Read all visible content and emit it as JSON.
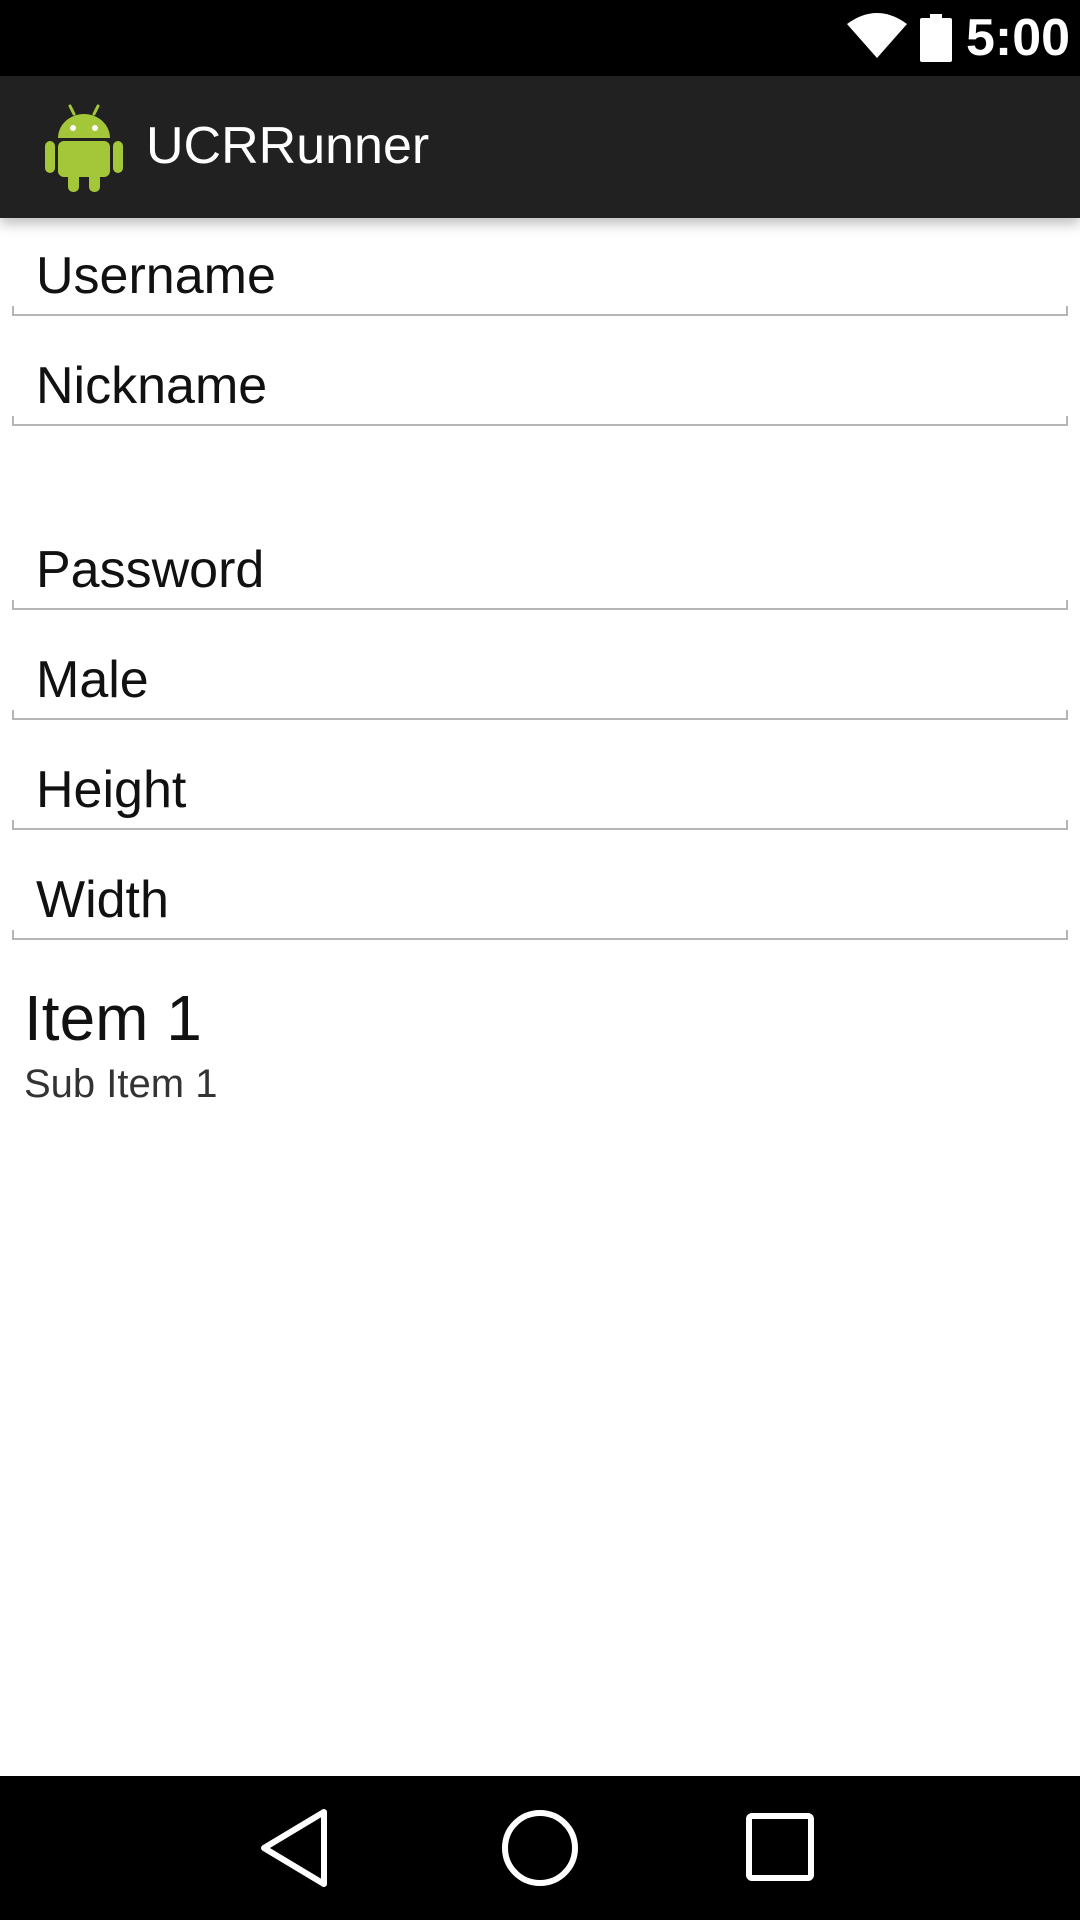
{
  "status_bar": {
    "time": "5:00",
    "wifi_icon": "wifi-icon",
    "battery_icon": "battery-icon"
  },
  "action_bar": {
    "title": "UCRRunner",
    "icon": "android-icon"
  },
  "form": {
    "username_hint": "Username",
    "nickname_hint": "Nickname",
    "password_hint": "Password",
    "gender_hint": "Male",
    "height_hint": "Height",
    "width_hint": "Width"
  },
  "list": {
    "items": [
      {
        "title": "Item 1",
        "subtitle": "Sub Item 1"
      }
    ]
  },
  "nav_bar": {
    "back_icon": "back-icon",
    "home_icon": "home-icon",
    "recents_icon": "recents-icon"
  },
  "colors": {
    "status_bar": "#000000",
    "action_bar": "#212121",
    "background": "#ffffff",
    "underline": "#b5b5b5",
    "android_green": "#a4c639"
  }
}
